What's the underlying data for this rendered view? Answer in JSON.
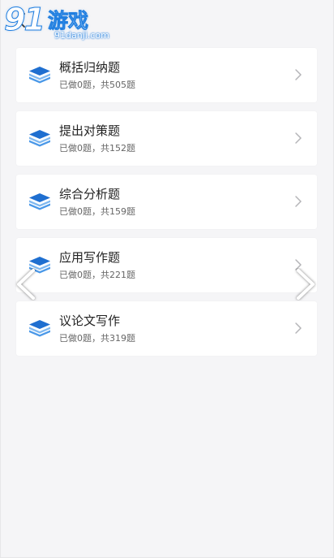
{
  "logo": {
    "digits": "91",
    "name": "游戏",
    "url": "91danji.com"
  },
  "items": [
    {
      "title": "概括归纳题",
      "progress": "已做0题，共505题"
    },
    {
      "title": "提出对策题",
      "progress": "已做0题，共152题"
    },
    {
      "title": "综合分析题",
      "progress": "已做0题，共159题"
    },
    {
      "title": "应用写作题",
      "progress": "已做0题，共221题"
    },
    {
      "title": "议论文写作",
      "progress": "已做0题，共319题"
    }
  ],
  "colors": {
    "accent": "#1f7ee0",
    "icon_light": "#7fb8f0",
    "background": "#f5f5f7"
  }
}
